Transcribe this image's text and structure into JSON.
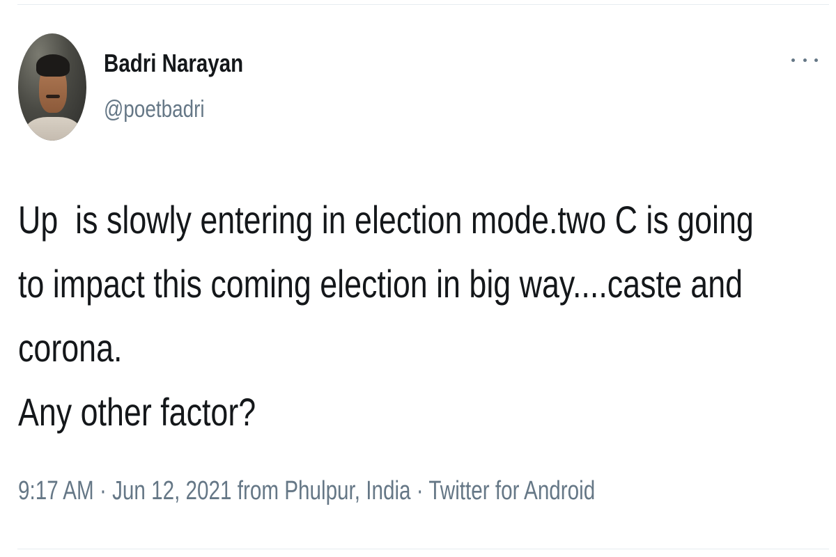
{
  "author": {
    "display_name": "Badri Narayan",
    "handle": "@poetbadri"
  },
  "tweet": {
    "lines": [
      "Up  is slowly entering in election mode.two C is going",
      "to impact this coming election in big way....caste and",
      "corona.",
      "Any other factor?"
    ]
  },
  "meta": {
    "time": "9:17 AM",
    "separator": "·",
    "date_location": "Jun 12, 2021 from Phulpur, India",
    "source": "Twitter for Android"
  },
  "icons": {
    "more": "more-horizontal-icon"
  },
  "colors": {
    "primary_text": "#14171a",
    "secondary_text": "#657786",
    "divider": "#e6ecf0"
  }
}
